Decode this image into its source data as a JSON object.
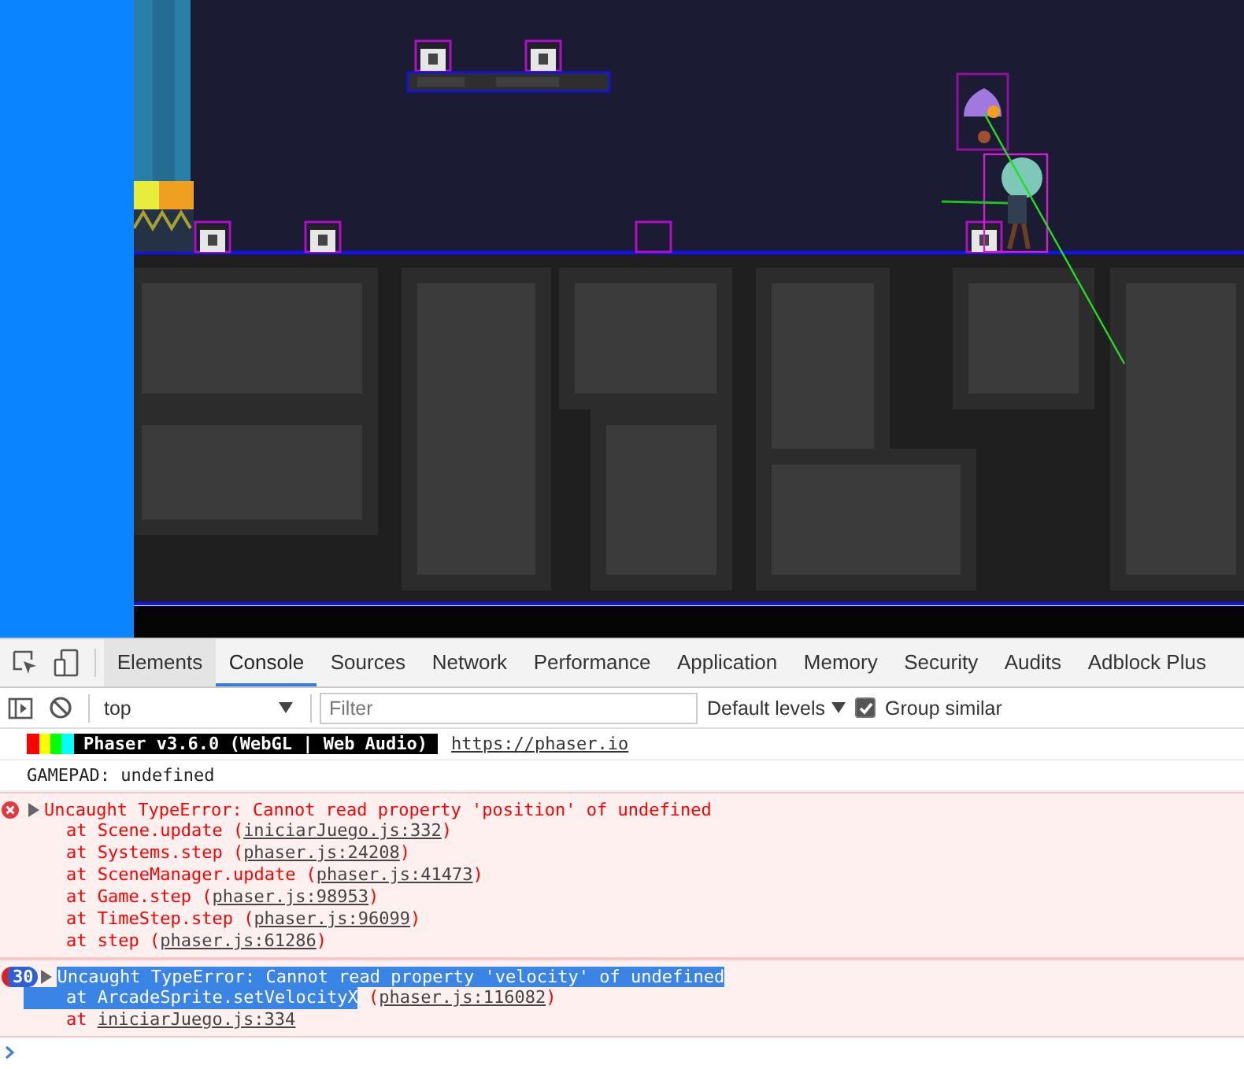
{
  "devtools": {
    "tabs": [
      {
        "label": "Elements",
        "selected": false,
        "hovered": true
      },
      {
        "label": "Console",
        "selected": true,
        "hovered": false
      },
      {
        "label": "Sources",
        "selected": false,
        "hovered": false
      },
      {
        "label": "Network",
        "selected": false,
        "hovered": false
      },
      {
        "label": "Performance",
        "selected": false,
        "hovered": false
      },
      {
        "label": "Application",
        "selected": false,
        "hovered": false
      },
      {
        "label": "Memory",
        "selected": false,
        "hovered": false
      },
      {
        "label": "Security",
        "selected": false,
        "hovered": false
      },
      {
        "label": "Audits",
        "selected": false,
        "hovered": false
      },
      {
        "label": "Adblock Plus",
        "selected": false,
        "hovered": false
      }
    ],
    "toolbar": {
      "context": "top",
      "filter_placeholder": "Filter",
      "levels": "Default levels",
      "group_similar": {
        "label": "Group similar",
        "checked": true
      }
    },
    "console": [
      {
        "kind": "banner",
        "label": "Phaser v3.6.0 (WebGL | Web Audio)",
        "link": "https://phaser.io"
      },
      {
        "kind": "log",
        "text": "GAMEPAD: undefined"
      },
      {
        "kind": "error",
        "message": "Uncaught TypeError: Cannot read property 'position' of undefined",
        "selected": false,
        "frames": [
          {
            "call": "at Scene.update",
            "open": "(",
            "link": "iniciarJuego.js:332",
            "close": ")",
            "selected": false
          },
          {
            "call": "at Systems.step",
            "open": "(",
            "link": "phaser.js:24208",
            "close": ")",
            "selected": false
          },
          {
            "call": "at SceneManager.update",
            "open": "(",
            "link": "phaser.js:41473",
            "close": ")",
            "selected": false
          },
          {
            "call": "at Game.step",
            "open": "(",
            "link": "phaser.js:98953",
            "close": ")",
            "selected": false
          },
          {
            "call": "at TimeStep.step",
            "open": "(",
            "link": "phaser.js:96099",
            "close": ")",
            "selected": false
          },
          {
            "call": "at step",
            "open": "(",
            "link": "phaser.js:61286",
            "close": ")",
            "selected": false
          }
        ]
      },
      {
        "kind": "error",
        "count": "30",
        "message": "Uncaught TypeError: Cannot read property 'velocity' of undefined",
        "selected": true,
        "frames": [
          {
            "call": "at ArcadeSprite.setVelocityX",
            "open": "(",
            "link": "phaser.js:116082",
            "close": ")",
            "selected": true
          },
          {
            "call": "at",
            "link": "iniciarJuego.js:334",
            "selected": false
          }
        ]
      }
    ]
  }
}
